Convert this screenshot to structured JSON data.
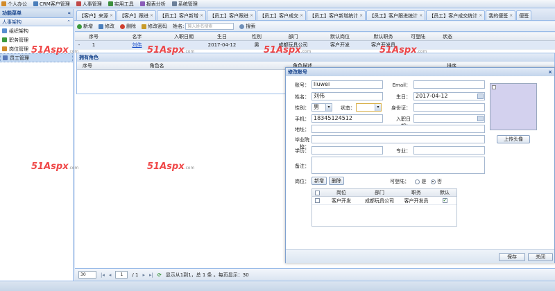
{
  "topmenu": [
    {
      "label": "个人办公",
      "color": "#d28b2a"
    },
    {
      "label": "CRM客户管理",
      "color": "#4a7ebb"
    },
    {
      "label": "人事管理",
      "color": "#c04848"
    },
    {
      "label": "实用工具",
      "color": "#3c8f3c"
    },
    {
      "label": "报表分析",
      "color": "#8a5cb8"
    },
    {
      "label": "系统管理",
      "color": "#6b7f99"
    }
  ],
  "sidebar": {
    "header": "功能菜单",
    "section": "人事架构",
    "items": [
      {
        "label": "组织架构",
        "color": "#5a8fd0"
      },
      {
        "label": "职务管理",
        "color": "#3c9a3c"
      },
      {
        "label": "岗位管理",
        "color": "#d08a2a"
      },
      {
        "label": "员工管理",
        "color": "#5a79b8"
      }
    ]
  },
  "tabs": [
    "【客户】来源",
    "【客户】跟进",
    "【员工】客户新增",
    "【员工】客户跟进",
    "【员工】客户成交",
    "【员工】客户新增统计",
    "【员工】客户跟进统计",
    "【员工】客户成交统计",
    "我的便签",
    "便签"
  ],
  "toolbar": {
    "add": "新增",
    "edit": "修改",
    "delete": "删除",
    "change_password": "修改密码",
    "name_label": "姓名:",
    "search_placeholder": "输入姓名搜索",
    "search": "搜索"
  },
  "grid": {
    "headers": [
      "",
      "序号",
      "名字",
      "入职日期",
      "生日",
      "性别",
      "部门",
      "默认岗位",
      "默认职务",
      "可登陆",
      "状态"
    ],
    "rows": [
      [
        "-",
        "1",
        "刘伟",
        "",
        "2017-04-12",
        "男",
        "成都玩具公司",
        "客户开发",
        "客户开发员",
        "",
        ""
      ]
    ]
  },
  "sub_panel": {
    "title": "拥有角色",
    "headers": [
      "序号",
      "角色名",
      "角色描述",
      "排序"
    ]
  },
  "pager": {
    "page_size": "30",
    "page": "1",
    "total_pages": "/ 1",
    "info": "显示从1到1，总 1 条 。每页显示：30"
  },
  "watermark": {
    "main": "51Aspx",
    "suffix": ".com"
  },
  "dialog": {
    "title": "修改账号",
    "account_label": "账号：",
    "account": "liuwei",
    "email_label": "Email：",
    "email": "",
    "name_label": "姓名：",
    "name": "刘伟",
    "birthday_label": "生日：",
    "birthday": "2017-04-12",
    "gender_label": "性别：",
    "gender": "男",
    "status_label": "状态：",
    "status": "",
    "idcard_label": "身份证：",
    "phone_label": "手机：",
    "phone": "18345124512",
    "hire_date_label": "入职日期：",
    "address_label": "地址：",
    "school_label": "毕业院校：",
    "education_label": "学历：",
    "major_label": "专业：",
    "remark_label": "备注：",
    "upload_avatar": "上传头像",
    "position_label": "岗位：",
    "add_btn": "新增",
    "del_btn": "删除",
    "login_label": "可登陆：",
    "login_yes": "是",
    "login_no": "否",
    "pos_headers": [
      "",
      "岗位",
      "部门",
      "职务",
      "默认"
    ],
    "pos_rows": [
      [
        "",
        "客户开发",
        "成都玩具公司",
        "客户开发员",
        ""
      ]
    ],
    "save": "保存",
    "close": "关闭"
  }
}
